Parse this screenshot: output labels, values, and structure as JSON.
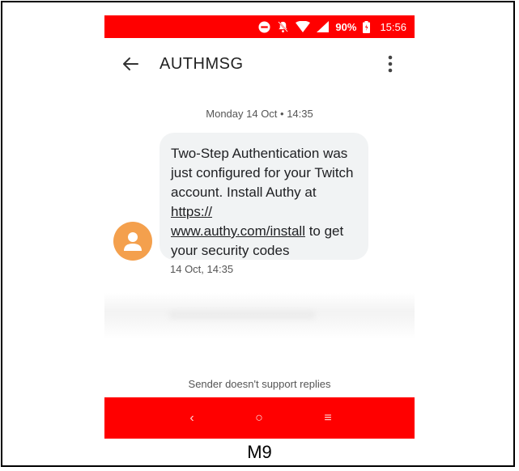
{
  "status_bar": {
    "battery": "90%",
    "time": "15:56",
    "icons": [
      "do-not-disturb-icon",
      "notifications-off-icon",
      "wifi-icon",
      "signal-icon",
      "battery-icon"
    ]
  },
  "app_bar": {
    "title": "AUTHMSG",
    "icons": [
      "back-arrow-icon",
      "more-vert-icon"
    ]
  },
  "conversation": {
    "date_label": "Monday 14 Oct • 14:35",
    "message": {
      "text_before_link": "Two-Step Authentication was just configured for your Twitch account. Install Authy at ",
      "link_line1": "https://",
      "link_line2": "www.authy.com/install",
      "text_after_link": " to get your security codes",
      "timestamp": "14 Oct, 14:35"
    },
    "footer_notice": "Sender doesn't support replies"
  },
  "nav_bar": {
    "back_glyph": "‹",
    "home_glyph": "○",
    "recents_glyph": "≡"
  },
  "caption": "M9",
  "colors": {
    "status_bar": "#ff0000",
    "nav_bar": "#ff0000",
    "avatar": "#f4a04d",
    "bubble": "#f1f3f4"
  }
}
